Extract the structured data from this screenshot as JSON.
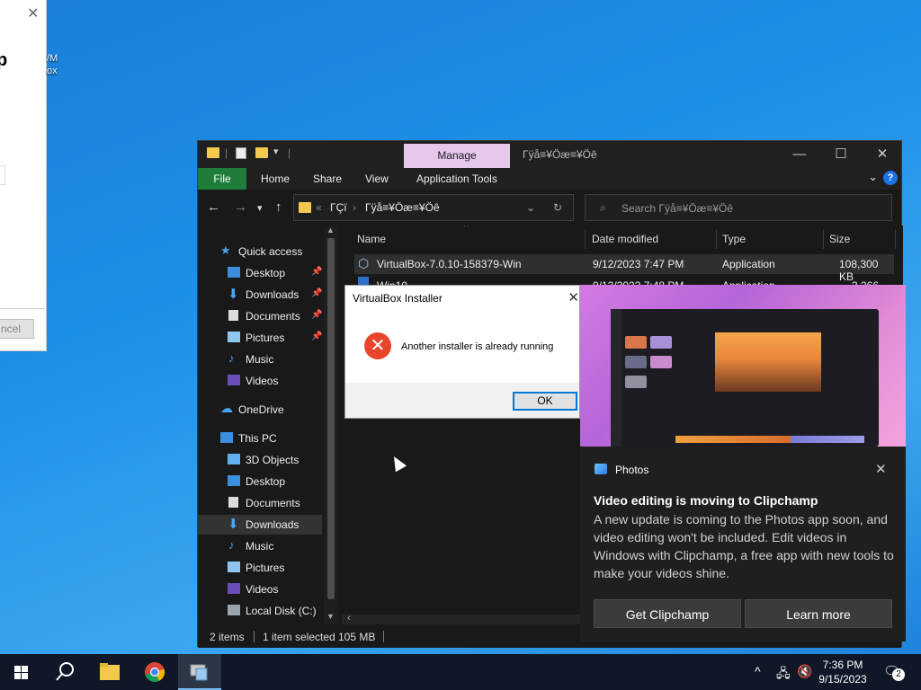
{
  "background_window": {
    "big_text": "p",
    "cancel_label": "ncel"
  },
  "desktop_icon": {
    "line1": "/M",
    "line2": "ox"
  },
  "explorer": {
    "title": "Γÿå≡¥Öæ≡¥Öê",
    "manage_tab": "Manage",
    "ribbon": {
      "file": "File",
      "home": "Home",
      "share": "Share",
      "view": "View",
      "app_tools": "Application Tools"
    },
    "address": {
      "parent": "ΓÇï",
      "current": "Γÿå≡¥Öæ≡¥Öê"
    },
    "search_placeholder": "Search Γÿå≡¥Öæ≡¥Öê",
    "nav": {
      "quick_access": "Quick access",
      "qa_items": [
        "Desktop",
        "Downloads",
        "Documents",
        "Pictures",
        "Music",
        "Videos"
      ],
      "onedrive": "OneDrive",
      "this_pc": "This PC",
      "pc_items": [
        "3D Objects",
        "Desktop",
        "Documents",
        "Downloads",
        "Music",
        "Pictures",
        "Videos",
        "Local Disk (C:)"
      ]
    },
    "columns": {
      "name": "Name",
      "date": "Date modified",
      "type": "Type",
      "size": "Size"
    },
    "files": [
      {
        "name": "VirtualBox-7.0.10-158379-Win",
        "date": "9/12/2023 7:47 PM",
        "type": "Application",
        "size": "108,300 KB"
      },
      {
        "name": "Win10",
        "date": "9/12/2023 7:48 PM",
        "type": "Application",
        "size": "3,266 KB"
      }
    ],
    "status": {
      "items": "2 items",
      "selected": "1 item selected",
      "size": "105 MB"
    }
  },
  "dialog": {
    "title": "VirtualBox Installer",
    "message": "Another installer is already running",
    "ok": "OK"
  },
  "toast": {
    "app": "Photos",
    "heading": "Video editing is moving to Clipchamp",
    "body": "A new update is coming to the Photos app soon, and video editing won't be included. Edit videos in Windows with Clipchamp, a free app with new tools to make your videos shine.",
    "btn_primary": "Get Clipchamp",
    "btn_secondary": "Learn more"
  },
  "taskbar": {
    "time": "7:36 PM",
    "date": "9/15/2023",
    "notification_count": "2"
  }
}
